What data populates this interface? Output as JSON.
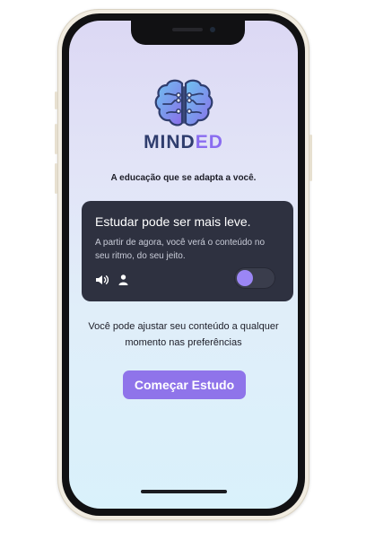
{
  "brand": {
    "name_primary": "MIND",
    "name_accent": "ED",
    "logo_icon": "brain-circuit-icon"
  },
  "tagline": "A educação que se adapta a você.",
  "card": {
    "title": "Estudar pode ser mais leve.",
    "body": "A partir de agora, você verá o conteúdo no seu ritmo, do seu jeito.",
    "icons": [
      "speaker-icon",
      "person-icon"
    ],
    "toggle_on": false
  },
  "hint": "Você pode ajustar seu conteúdo a qualquer momento nas preferências",
  "cta_label": "Começar Estudo",
  "colors": {
    "accent": "#8f74ea",
    "brand_dark": "#2f3d6e",
    "card_bg": "#2e3140"
  }
}
